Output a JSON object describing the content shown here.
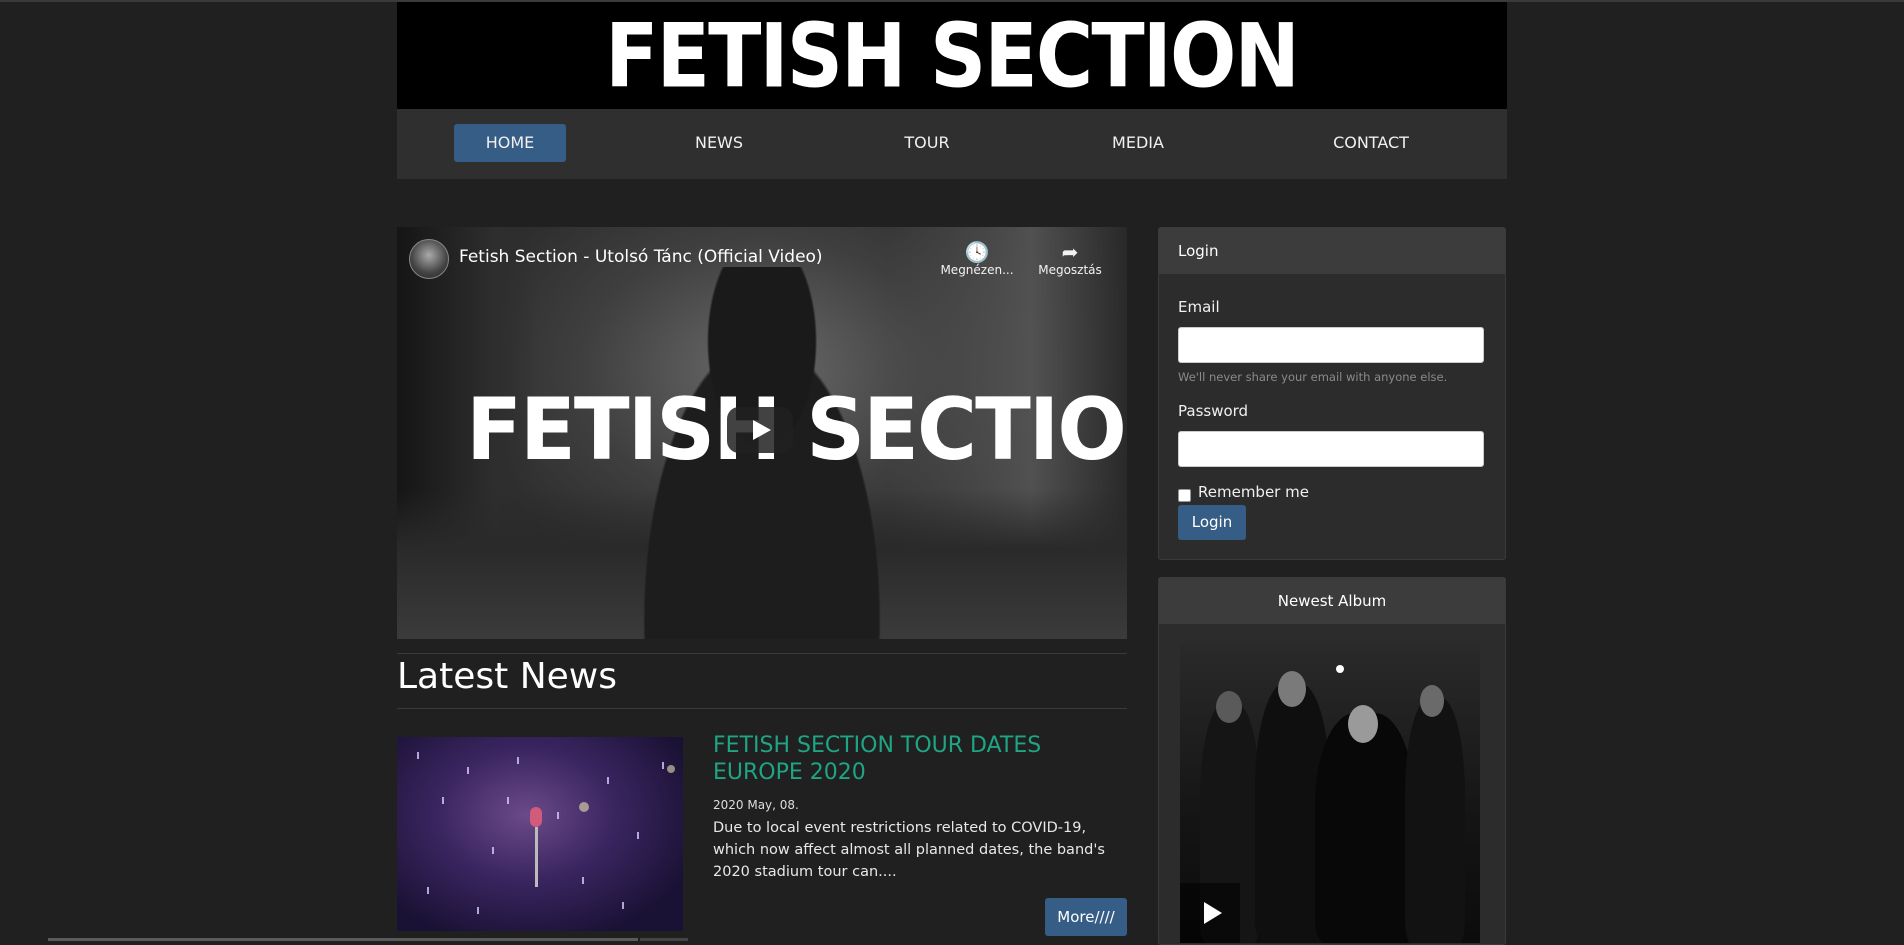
{
  "header": {
    "logo_text": "FETISH SECTION"
  },
  "nav": {
    "items": [
      {
        "label": "HOME",
        "active": true
      },
      {
        "label": "NEWS"
      },
      {
        "label": "TOUR"
      },
      {
        "label": "MEDIA"
      },
      {
        "label": "CONTACT"
      }
    ]
  },
  "video": {
    "title": "Fetish Section - Utolsó Tánc (Official Video)",
    "watch_later_label": "Megnézen...",
    "share_label": "Megosztás",
    "overlay_logo": "FETISH SECTION",
    "icons": [
      "clock-icon",
      "share-icon",
      "play-icon"
    ]
  },
  "news": {
    "heading": "Latest News",
    "items": [
      {
        "title": "FETISH SECTION TOUR DATES EUROPE 2020",
        "date": "2020 May, 08.",
        "excerpt": "Due to local event restrictions related to COVID-19, which now affect almost all planned dates, the band's 2020 stadium tour can....",
        "more_label": "More////"
      }
    ]
  },
  "login": {
    "heading": "Login",
    "email_label": "Email",
    "email_value": "",
    "email_hint": "We'll never share your email with anyone else.",
    "password_label": "Password",
    "password_value": "",
    "remember_label": "Remember me",
    "button_label": "Login"
  },
  "album": {
    "heading": "Newest Album"
  },
  "colors": {
    "background": "#202020",
    "nav_bg": "#2f2f2f",
    "accent_blue": "#365d85",
    "news_title_green": "#1fa584"
  }
}
